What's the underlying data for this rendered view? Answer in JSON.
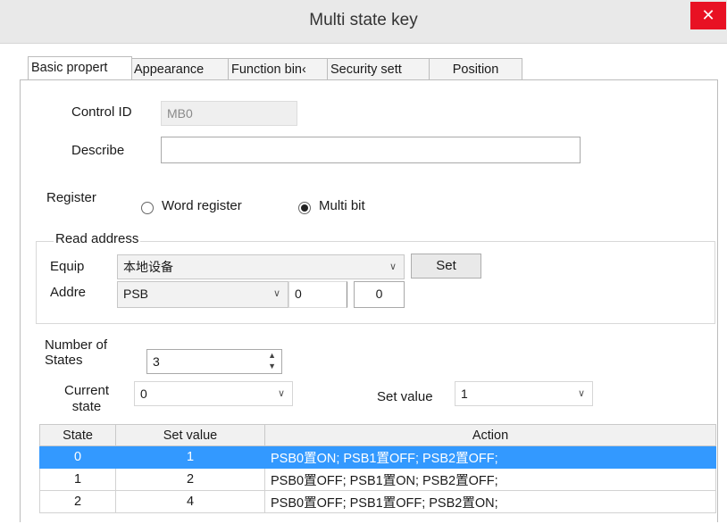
{
  "window": {
    "title": "Multi state key",
    "close_glyph": "✕"
  },
  "tabs": [
    {
      "label": "Basic propert",
      "active": true
    },
    {
      "label": "Appearance",
      "active": false
    },
    {
      "label": "Function bin‹",
      "active": false
    },
    {
      "label": "Security sett",
      "active": false
    },
    {
      "label": "Position",
      "active": false
    }
  ],
  "basic": {
    "control_id_label": "Control ID",
    "control_id_value": "MB0",
    "describe_label": "Describe",
    "describe_value": ""
  },
  "register": {
    "label": "Register",
    "options": [
      {
        "label": "Word register",
        "selected": false
      },
      {
        "label": "Multi bit",
        "selected": true
      }
    ]
  },
  "read_address": {
    "group_label": "Read address",
    "equip_label": "Equip",
    "equip_value": "本地设备",
    "set_button": "Set",
    "addr_label": "Addre",
    "addr_type": "PSB",
    "addr_value": "0",
    "addr_offset": "0"
  },
  "states": {
    "number_label_1": "Number of",
    "number_label_2": "States",
    "number_value": "3",
    "current_label_1": "Current",
    "current_label_2": "state",
    "current_value": "0",
    "set_value_label": "Set value",
    "set_value_value": "1"
  },
  "table": {
    "headers": [
      "State",
      "Set value",
      "Action"
    ],
    "rows": [
      {
        "state": "0",
        "set_value": "1",
        "action": "PSB0置ON; PSB1置OFF; PSB2置OFF;",
        "selected": true
      },
      {
        "state": "1",
        "set_value": "2",
        "action": "PSB0置OFF; PSB1置ON; PSB2置OFF;",
        "selected": false
      },
      {
        "state": "2",
        "set_value": "4",
        "action": "PSB0置OFF; PSB1置OFF; PSB2置ON;",
        "selected": false
      }
    ]
  },
  "icons": {
    "dropdown": "chevron-down-icon",
    "spinner": "spinner-arrows-icon"
  },
  "colors": {
    "selection": "#3399ff",
    "close_button": "#e81123"
  }
}
